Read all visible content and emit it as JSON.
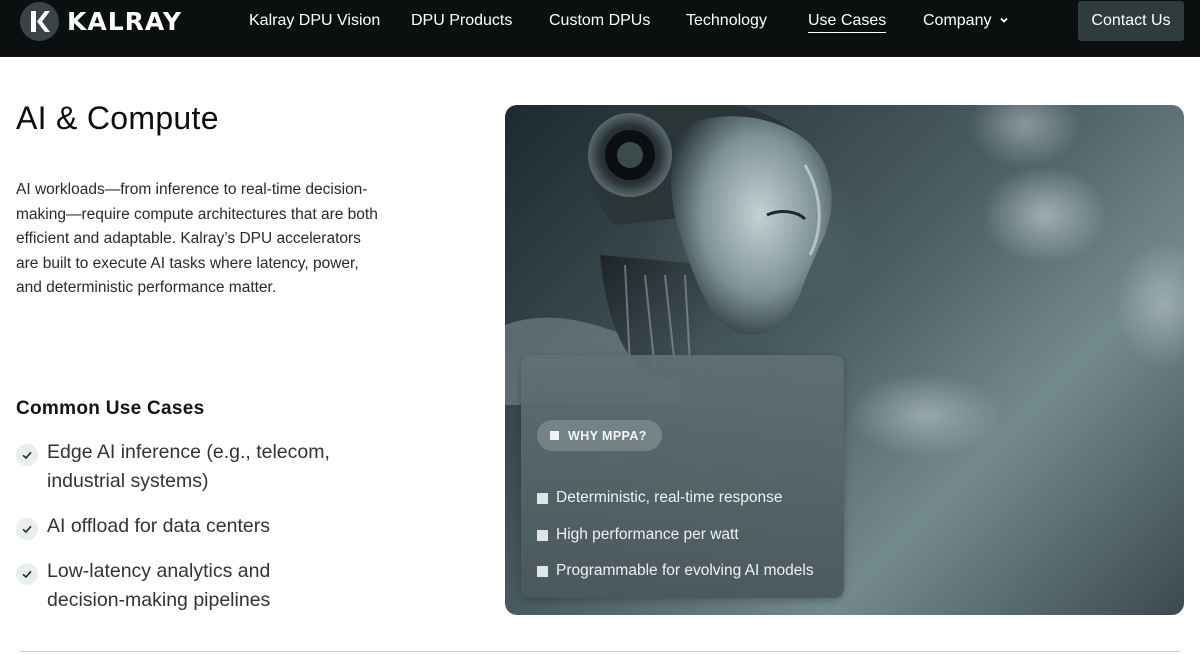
{
  "brand": {
    "name": "KALRAY",
    "logo_letter": "K"
  },
  "nav": {
    "items": [
      {
        "label": "Kalray DPU Vision"
      },
      {
        "label": "DPU Products"
      },
      {
        "label": "Custom DPUs"
      },
      {
        "label": "Technology"
      },
      {
        "label": "Use Cases",
        "active": true
      },
      {
        "label": "Company",
        "has_dropdown": true
      }
    ],
    "contact_label": "Contact Us"
  },
  "main": {
    "title": "AI & Compute",
    "intro": "AI workloads—from inference to real-time decision-making—require compute architectures that are both efficient and adaptable. Kalray’s DPU accelerators are built to execute AI tasks where latency, power, and deterministic performance matter.",
    "use_cases_title": "Common Use Cases",
    "use_cases": [
      "Edge AI inference (e.g., telecom, industrial systems)",
      "AI offload for data centers",
      "Low-latency analytics and decision-making pipelines"
    ]
  },
  "hero": {
    "badge": "WHY MPPA?",
    "features": [
      "Deterministic, real-time response",
      "High performance per watt",
      "Programmable for evolving AI models"
    ]
  },
  "colors": {
    "nav_bg": "#0b0f10",
    "contact_bg": "#2f3b3d",
    "check_bg": "#e9efec",
    "check_color": "#1f2d2a"
  },
  "icons": {
    "logo": "kalray-k-logo-icon",
    "dropdown": "chevron-down-icon",
    "check": "check-icon",
    "bullet": "square-bullet-icon"
  }
}
